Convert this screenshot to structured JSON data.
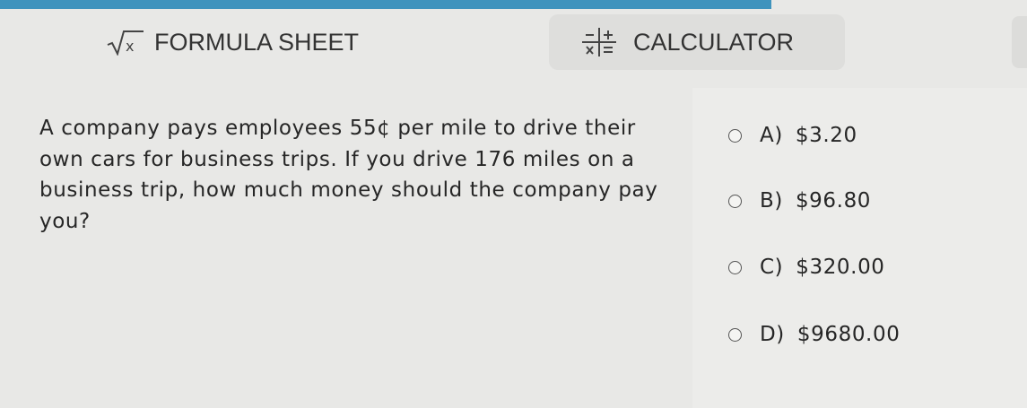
{
  "toolbar": {
    "formula_label": "FORMULA SHEET",
    "calculator_label": "CALCULATOR",
    "formula_icon": "square-root-icon",
    "calculator_icon": "calculator-operators-icon"
  },
  "question": {
    "text": "A company pays employees 55¢ per mile to drive their own cars for business trips. If you drive 176 miles on a business trip, how much money should the company pay you?"
  },
  "choices": [
    {
      "letter": "A)",
      "value": "$3.20"
    },
    {
      "letter": "B)",
      "value": "$96.80"
    },
    {
      "letter": "C)",
      "value": "$320.00"
    },
    {
      "letter": "D)",
      "value": "$9680.00"
    }
  ],
  "colors": {
    "accent": "#3f93bd",
    "background": "#e8e8e6",
    "text": "#262626"
  }
}
